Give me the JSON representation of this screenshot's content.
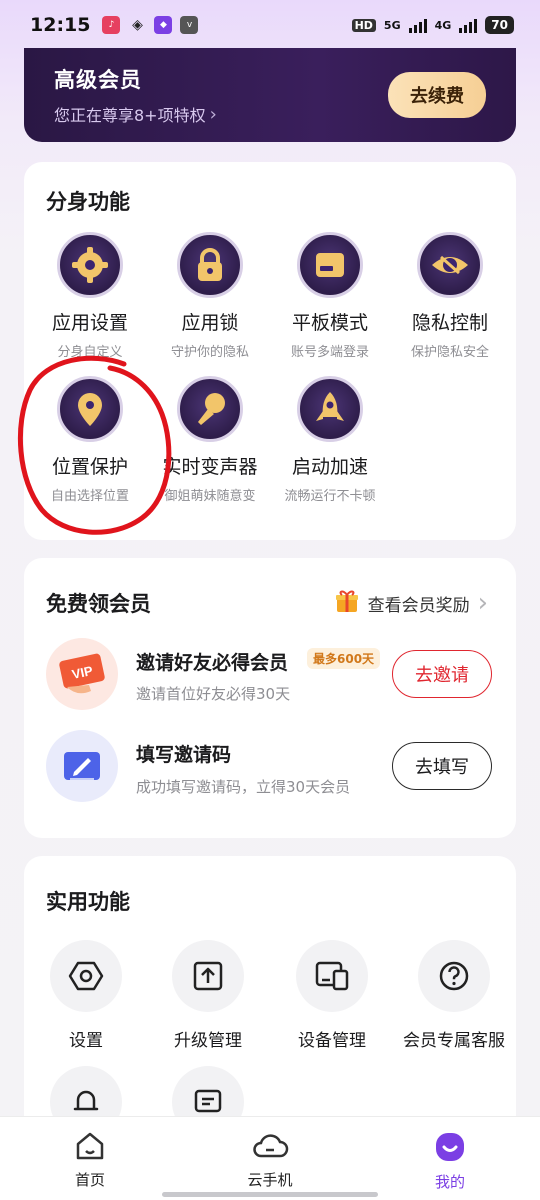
{
  "status_bar": {
    "time": "12:15",
    "network1": "5G",
    "network2": "4G",
    "battery": "70",
    "hd": "HD"
  },
  "vip_banner": {
    "title": "高级会员",
    "subtitle": "您正在尊享8+项特权",
    "renew_button": "去续费"
  },
  "clone_features": {
    "title": "分身功能",
    "items": [
      {
        "label": "应用设置",
        "sub": "分身自定义",
        "icon": "gear-icon"
      },
      {
        "label": "应用锁",
        "sub": "守护你的隐私",
        "icon": "padlock-icon"
      },
      {
        "label": "平板模式",
        "sub": "账号多端登录",
        "icon": "tablet-icon"
      },
      {
        "label": "隐私控制",
        "sub": "保护隐私安全",
        "icon": "eye-slash-icon"
      },
      {
        "label": "位置保护",
        "sub": "自由选择位置",
        "icon": "location-pin-icon"
      },
      {
        "label": "实时变声器",
        "sub": "御姐萌妹随意变",
        "icon": "microphone-icon"
      },
      {
        "label": "启动加速",
        "sub": "流畅运行不卡顿",
        "icon": "rocket-icon"
      }
    ]
  },
  "free_vip": {
    "title": "免费领会员",
    "rewards_link": "查看会员奖励",
    "rows": [
      {
        "title": "邀请好友必得会员",
        "tag": "最多600天",
        "sub": "邀请首位好友必得30天",
        "button": "去邀请"
      },
      {
        "title": "填写邀请码",
        "sub": "成功填写邀请码，立得30天会员",
        "button": "去填写"
      }
    ],
    "vip_badge": "VIP"
  },
  "utilities": {
    "title": "实用功能",
    "items": [
      {
        "label": "设置",
        "icon": "hexagon-settings-icon"
      },
      {
        "label": "升级管理",
        "icon": "upgrade-icon"
      },
      {
        "label": "设备管理",
        "icon": "device-icon"
      },
      {
        "label": "会员专属客服",
        "icon": "help-icon"
      }
    ]
  },
  "bottom_nav": {
    "items": [
      {
        "label": "首页",
        "icon": "home-icon"
      },
      {
        "label": "云手机",
        "icon": "cloud-icon"
      },
      {
        "label": "我的",
        "icon": "profile-icon",
        "active": true
      }
    ]
  },
  "colors": {
    "accent_purple": "#7b3fe4",
    "invite_red": "#e0262f",
    "annotation_red": "#e0141c"
  }
}
